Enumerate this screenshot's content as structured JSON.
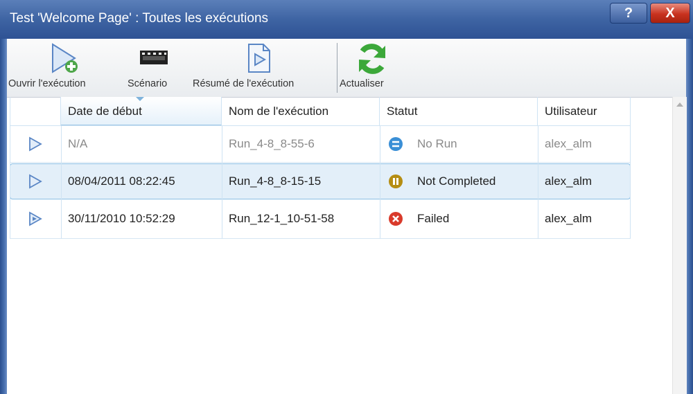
{
  "window": {
    "title": "Test 'Welcome Page' : Toutes les exécutions",
    "help_label": "?",
    "close_label": "X"
  },
  "toolbar": {
    "open_run_label": "Ouvrir l'exécution",
    "scenario_label": "Scénario",
    "run_summary_label": "Résumé de l'exécution",
    "refresh_label": "Actualiser"
  },
  "table": {
    "columns": [
      "Date de début",
      "Nom de l'exécution",
      "Statut",
      "Utilisateur"
    ],
    "rows": [
      {
        "start_date": "N/A",
        "run_name": "Run_4-8_8-55-6",
        "status": "No Run",
        "status_icon": "no-run-icon",
        "user": "alex_alm",
        "dimmed": true
      },
      {
        "start_date": "08/04/2011 08:22:45",
        "run_name": "Run_4-8_8-15-15",
        "status": "Not Completed",
        "status_icon": "not-completed-icon",
        "user": "alex_alm",
        "selected": true
      },
      {
        "start_date": "30/11/2010 10:52:29",
        "run_name": "Run_12-1_10-51-58",
        "status": "Failed",
        "status_icon": "failed-icon",
        "user": "alex_alm"
      }
    ]
  },
  "colors": {
    "titlebar": "#3e64a3",
    "selection": "#e3eff9",
    "no_run": "#3a8fd6",
    "not_completed": "#b58d12",
    "failed": "#d93a2b",
    "refresh": "#3ca83a"
  }
}
